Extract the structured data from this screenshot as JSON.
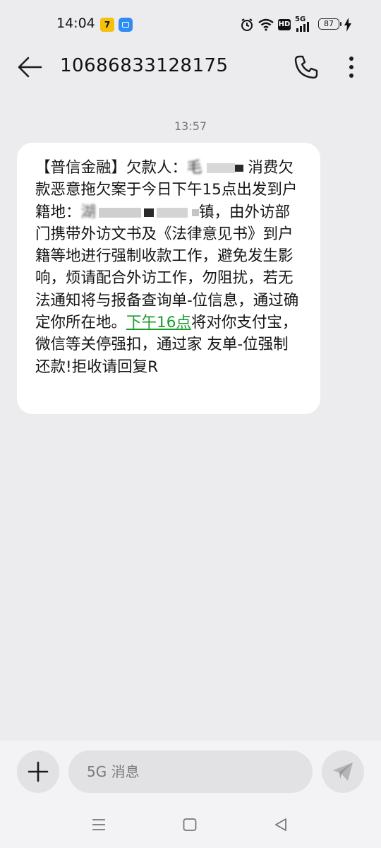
{
  "status_bar": {
    "time": "14:04",
    "app_badge": "7",
    "battery": "87",
    "network": "5G",
    "hd": "HD"
  },
  "header": {
    "contact": "10686833128175",
    "back_icon": "arrow-left-icon",
    "call_icon": "phone-icon",
    "more_icon": "more-vertical-icon"
  },
  "conversation": {
    "timestamp": "13:57",
    "message": {
      "part_intro": "【普信金融】欠款人：",
      "name_fragment": "毛",
      "part_after_name": " 消费欠款恶意拖欠案于今日下午15点出发到户籍地：",
      "address_fragment": "湖",
      "part_main": "镇，由外访部门携带外访文书及《法律意见书》到户籍等地进行强制收款工作，避免发生影响，烦请配合外访工作，勿阻扰，若无法通知将与报备查询单-位信息，通过确定你所在地。",
      "link_text": "下午16点",
      "part_end": "将对你支付宝，微信等关停强扣，通过家 友单-位强制还款!拒收请回复R"
    }
  },
  "composer": {
    "placeholder": "5G 消息",
    "add_icon": "plus-icon",
    "send_icon": "send-icon"
  },
  "nav": {
    "recent_icon": "menu-lines-icon",
    "home_icon": "square-icon",
    "back_icon": "triangle-back-icon"
  },
  "colors": {
    "background": "#ececef",
    "bubble": "#ffffff",
    "link": "#1a9a2f"
  }
}
